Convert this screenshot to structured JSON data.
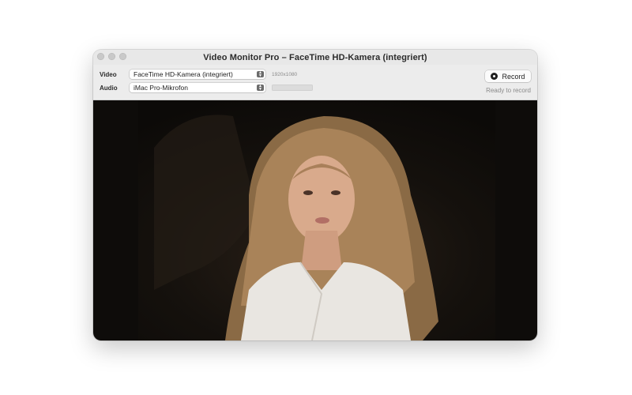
{
  "window": {
    "title": "Video Monitor Pro – FaceTime HD-Kamera (integriert)"
  },
  "toolbar": {
    "video_label": "Video",
    "video_device": "FaceTime HD-Kamera (integriert)",
    "resolution": "1920x1080",
    "audio_label": "Audio",
    "audio_device": "iMac Pro-Mikrofon",
    "audio_level": 0,
    "record_label": "Record",
    "status": "Ready to record"
  },
  "preview": {
    "content": "live camera preview"
  },
  "icons": {
    "record": "record-circle-icon",
    "popup": "updown-chevron-icon"
  }
}
